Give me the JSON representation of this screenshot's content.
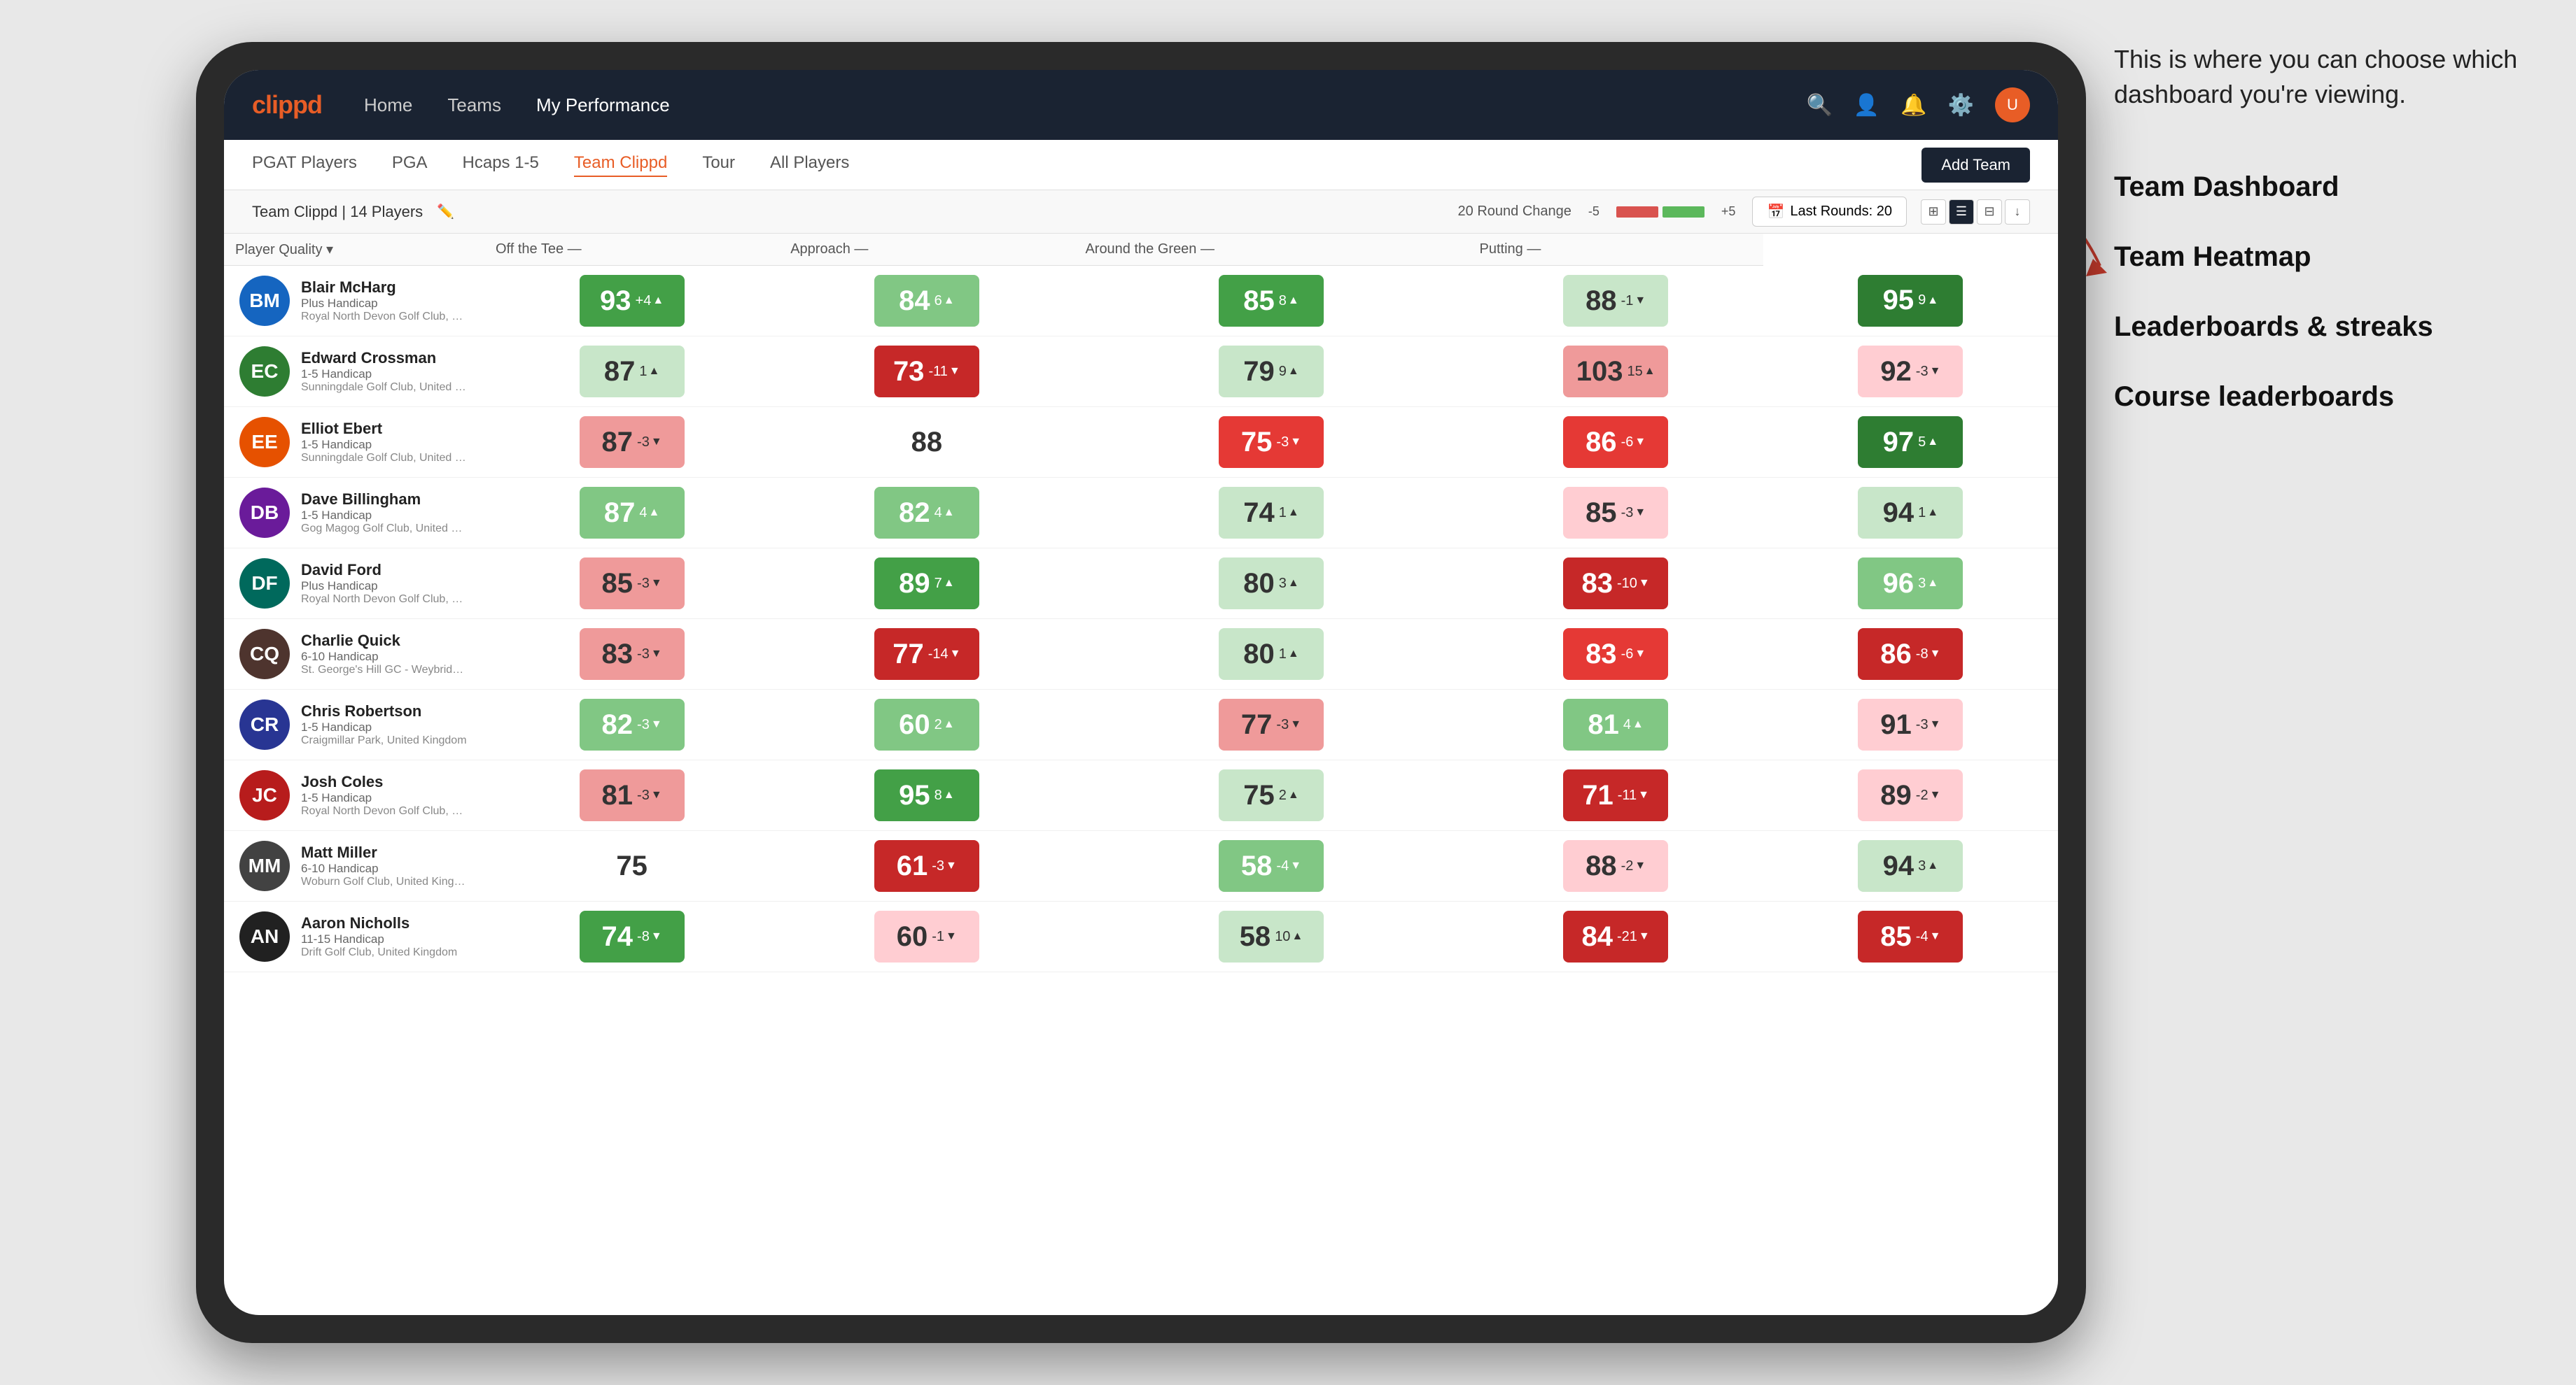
{
  "annotation": {
    "callout": "This is where you can choose which dashboard you're viewing.",
    "items": [
      "Team Dashboard",
      "Team Heatmap",
      "Leaderboards & streaks",
      "Course leaderboards"
    ]
  },
  "nav": {
    "logo": "clippd",
    "links": [
      "Home",
      "Teams",
      "My Performance"
    ],
    "active_link": "My Performance"
  },
  "sub_nav": {
    "links": [
      "PGAT Players",
      "PGA",
      "Hcaps 1-5",
      "Team Clippd",
      "Tour",
      "All Players"
    ],
    "active_link": "Team Clippd",
    "add_team_label": "Add Team"
  },
  "filter_bar": {
    "team_name": "Team Clippd",
    "player_count": "14 Players",
    "round_change_label": "20 Round Change",
    "range_neg": "-5",
    "range_pos": "+5",
    "last_rounds_label": "Last Rounds:",
    "last_rounds_value": "20"
  },
  "table": {
    "headers": {
      "player": "Player Quality",
      "off_tee": "Off the Tee",
      "approach": "Approach",
      "around_green": "Around the Green",
      "putting": "Putting"
    },
    "players": [
      {
        "name": "Blair McHarg",
        "handicap": "Plus Handicap",
        "club": "Royal North Devon Golf Club, United Kingdom",
        "avatar_initials": "BM",
        "avatar_class": "av-blue",
        "scores": {
          "player_quality": {
            "value": 93,
            "delta": "+4",
            "dir": "up",
            "color": "bg-green-mid"
          },
          "off_tee": {
            "value": 84,
            "delta": "6",
            "dir": "up",
            "color": "bg-green-light"
          },
          "approach": {
            "value": 85,
            "delta": "8",
            "dir": "up",
            "color": "bg-green-mid"
          },
          "around_green": {
            "value": 88,
            "delta": "-1",
            "dir": "down",
            "color": "bg-green-pale"
          },
          "putting": {
            "value": 95,
            "delta": "9",
            "dir": "up",
            "color": "bg-green-dark"
          }
        }
      },
      {
        "name": "Edward Crossman",
        "handicap": "1-5 Handicap",
        "club": "Sunningdale Golf Club, United Kingdom",
        "avatar_initials": "EC",
        "avatar_class": "av-green",
        "scores": {
          "player_quality": {
            "value": 87,
            "delta": "1",
            "dir": "up",
            "color": "bg-green-pale"
          },
          "off_tee": {
            "value": 73,
            "delta": "-11",
            "dir": "down",
            "color": "bg-red-dark"
          },
          "approach": {
            "value": 79,
            "delta": "9",
            "dir": "up",
            "color": "bg-green-pale"
          },
          "around_green": {
            "value": 103,
            "delta": "15",
            "dir": "up",
            "color": "bg-red-light"
          },
          "putting": {
            "value": 92,
            "delta": "-3",
            "dir": "down",
            "color": "bg-red-pale"
          }
        }
      },
      {
        "name": "Elliot Ebert",
        "handicap": "1-5 Handicap",
        "club": "Sunningdale Golf Club, United Kingdom",
        "avatar_initials": "EE",
        "avatar_class": "av-orange",
        "scores": {
          "player_quality": {
            "value": 87,
            "delta": "-3",
            "dir": "down",
            "color": "bg-red-light"
          },
          "off_tee": {
            "value": 88,
            "delta": "",
            "dir": "",
            "color": "bg-white"
          },
          "approach": {
            "value": 75,
            "delta": "-3",
            "dir": "down",
            "color": "bg-red-mid"
          },
          "around_green": {
            "value": 86,
            "delta": "-6",
            "dir": "down",
            "color": "bg-red-mid"
          },
          "putting": {
            "value": 97,
            "delta": "5",
            "dir": "up",
            "color": "bg-green-dark"
          }
        }
      },
      {
        "name": "Dave Billingham",
        "handicap": "1-5 Handicap",
        "club": "Gog Magog Golf Club, United Kingdom",
        "avatar_initials": "DB",
        "avatar_class": "av-purple",
        "scores": {
          "player_quality": {
            "value": 87,
            "delta": "4",
            "dir": "up",
            "color": "bg-green-light"
          },
          "off_tee": {
            "value": 82,
            "delta": "4",
            "dir": "up",
            "color": "bg-green-light"
          },
          "approach": {
            "value": 74,
            "delta": "1",
            "dir": "up",
            "color": "bg-green-pale"
          },
          "around_green": {
            "value": 85,
            "delta": "-3",
            "dir": "down",
            "color": "bg-red-pale"
          },
          "putting": {
            "value": 94,
            "delta": "1",
            "dir": "up",
            "color": "bg-green-pale"
          }
        }
      },
      {
        "name": "David Ford",
        "handicap": "Plus Handicap",
        "club": "Royal North Devon Golf Club, United Kingdom",
        "avatar_initials": "DF",
        "avatar_class": "av-teal",
        "scores": {
          "player_quality": {
            "value": 85,
            "delta": "-3",
            "dir": "down",
            "color": "bg-red-light"
          },
          "off_tee": {
            "value": 89,
            "delta": "7",
            "dir": "up",
            "color": "bg-green-mid"
          },
          "approach": {
            "value": 80,
            "delta": "3",
            "dir": "up",
            "color": "bg-green-pale"
          },
          "around_green": {
            "value": 83,
            "delta": "-10",
            "dir": "down",
            "color": "bg-red-dark"
          },
          "putting": {
            "value": 96,
            "delta": "3",
            "dir": "up",
            "color": "bg-green-light"
          }
        }
      },
      {
        "name": "Charlie Quick",
        "handicap": "6-10 Handicap",
        "club": "St. George's Hill GC - Weybridge - Surrey, Uni...",
        "avatar_initials": "CQ",
        "avatar_class": "av-brown",
        "scores": {
          "player_quality": {
            "value": 83,
            "delta": "-3",
            "dir": "down",
            "color": "bg-red-light"
          },
          "off_tee": {
            "value": 77,
            "delta": "-14",
            "dir": "down",
            "color": "bg-red-dark"
          },
          "approach": {
            "value": 80,
            "delta": "1",
            "dir": "up",
            "color": "bg-green-pale"
          },
          "around_green": {
            "value": 83,
            "delta": "-6",
            "dir": "down",
            "color": "bg-red-mid"
          },
          "putting": {
            "value": 86,
            "delta": "-8",
            "dir": "down",
            "color": "bg-red-dark"
          }
        }
      },
      {
        "name": "Chris Robertson",
        "handicap": "1-5 Handicap",
        "club": "Craigmillar Park, United Kingdom",
        "avatar_initials": "CR",
        "avatar_class": "av-indigo",
        "scores": {
          "player_quality": {
            "value": 82,
            "delta": "-3",
            "dir": "down",
            "color": "bg-green-light"
          },
          "off_tee": {
            "value": 60,
            "delta": "2",
            "dir": "up",
            "color": "bg-green-light"
          },
          "approach": {
            "value": 77,
            "delta": "-3",
            "dir": "down",
            "color": "bg-red-light"
          },
          "around_green": {
            "value": 81,
            "delta": "4",
            "dir": "up",
            "color": "bg-green-light"
          },
          "putting": {
            "value": 91,
            "delta": "-3",
            "dir": "down",
            "color": "bg-red-pale"
          }
        }
      },
      {
        "name": "Josh Coles",
        "handicap": "1-5 Handicap",
        "club": "Royal North Devon Golf Club, United Kingdom",
        "avatar_initials": "JC",
        "avatar_class": "av-red",
        "scores": {
          "player_quality": {
            "value": 81,
            "delta": "-3",
            "dir": "down",
            "color": "bg-red-light"
          },
          "off_tee": {
            "value": 95,
            "delta": "8",
            "dir": "up",
            "color": "bg-green-mid"
          },
          "approach": {
            "value": 75,
            "delta": "2",
            "dir": "up",
            "color": "bg-green-pale"
          },
          "around_green": {
            "value": 71,
            "delta": "-11",
            "dir": "down",
            "color": "bg-red-dark"
          },
          "putting": {
            "value": 89,
            "delta": "-2",
            "dir": "down",
            "color": "bg-red-pale"
          }
        }
      },
      {
        "name": "Matt Miller",
        "handicap": "6-10 Handicap",
        "club": "Woburn Golf Club, United Kingdom",
        "avatar_initials": "MM",
        "avatar_class": "av-gray",
        "scores": {
          "player_quality": {
            "value": 75,
            "delta": "",
            "dir": "",
            "color": "bg-white"
          },
          "off_tee": {
            "value": 61,
            "delta": "-3",
            "dir": "down",
            "color": "bg-red-dark"
          },
          "approach": {
            "value": 58,
            "delta": "-4",
            "dir": "down",
            "color": "bg-green-light"
          },
          "around_green": {
            "value": 88,
            "delta": "-2",
            "dir": "down",
            "color": "bg-red-pale"
          },
          "putting": {
            "value": 94,
            "delta": "3",
            "dir": "up",
            "color": "bg-green-pale"
          }
        }
      },
      {
        "name": "Aaron Nicholls",
        "handicap": "11-15 Handicap",
        "club": "Drift Golf Club, United Kingdom",
        "avatar_initials": "AN",
        "avatar_class": "av-dark",
        "scores": {
          "player_quality": {
            "value": 74,
            "delta": "-8",
            "dir": "down",
            "color": "bg-green-mid"
          },
          "off_tee": {
            "value": 60,
            "delta": "-1",
            "dir": "down",
            "color": "bg-red-pale"
          },
          "approach": {
            "value": 58,
            "delta": "10",
            "dir": "up",
            "color": "bg-green-pale"
          },
          "around_green": {
            "value": 84,
            "delta": "-21",
            "dir": "down",
            "color": "bg-red-dark"
          },
          "putting": {
            "value": 85,
            "delta": "-4",
            "dir": "down",
            "color": "bg-red-dark"
          }
        }
      }
    ]
  }
}
